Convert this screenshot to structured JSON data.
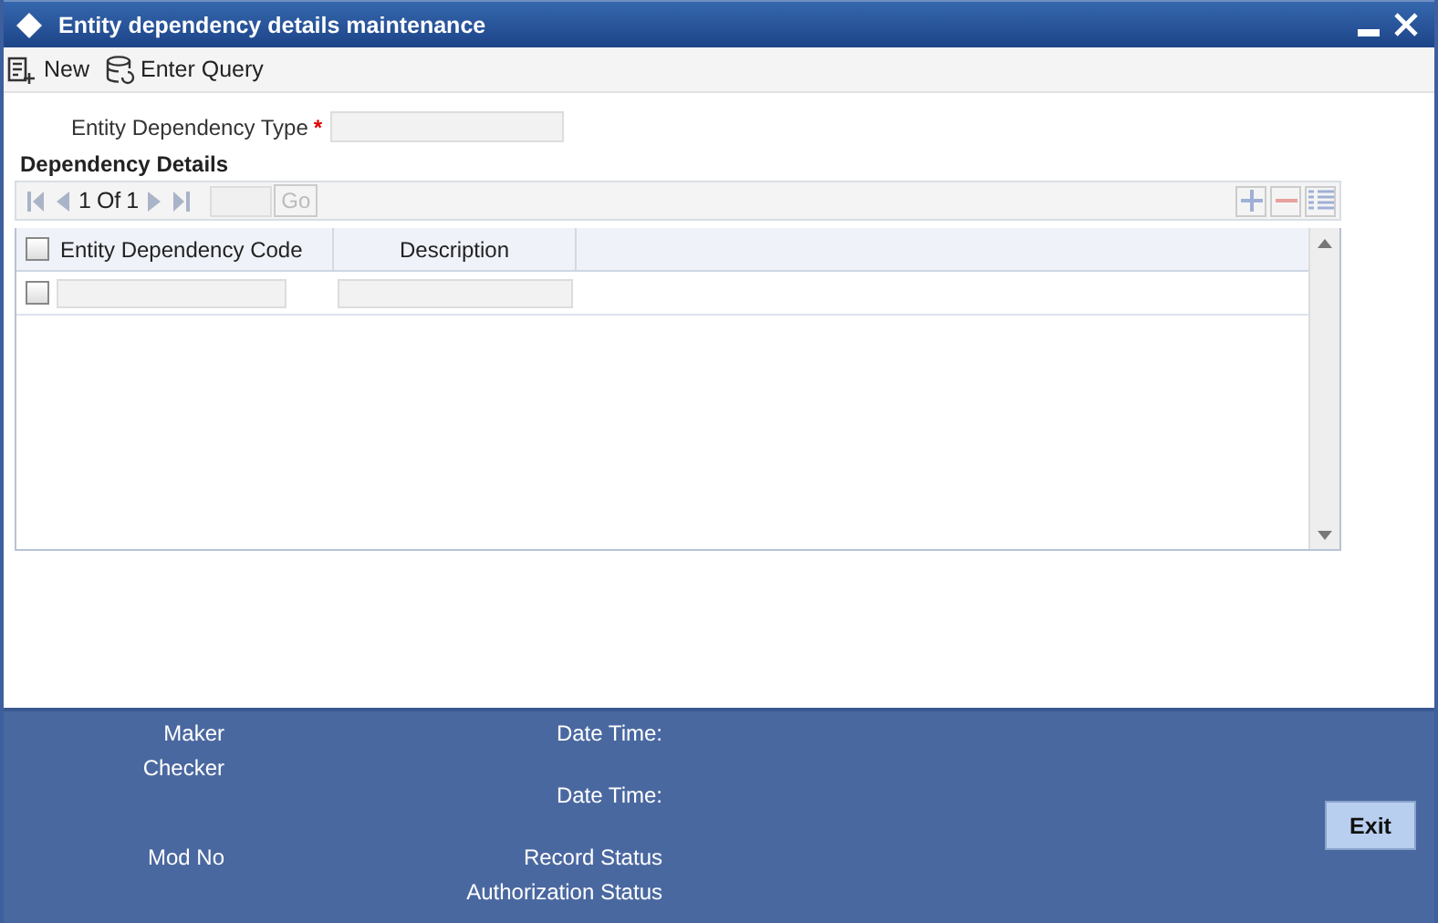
{
  "window": {
    "title": "Entity dependency details maintenance"
  },
  "toolbar": [
    {
      "kind": "new",
      "label": "New"
    },
    {
      "kind": "query",
      "label": "Enter Query"
    }
  ],
  "type_field": {
    "label": "Entity Dependency Type",
    "required_mark": "*"
  },
  "section": {
    "title": "Dependency Details",
    "pager": {
      "current": "1",
      "of": "Of",
      "total": "1",
      "go": "Go"
    },
    "columns": [
      "Entity Dependency Code",
      "Description"
    ],
    "header_checked": false,
    "rows": [
      {
        "checked": false
      }
    ]
  },
  "footer": {
    "maker": "Maker",
    "checker": "Checker",
    "mod_no": "Mod No",
    "date_time_1": "Date Time:",
    "date_time_2": "Date Time:",
    "record_status": "Record Status",
    "authorization_status": "Authorization Status",
    "exit": "Exit"
  }
}
